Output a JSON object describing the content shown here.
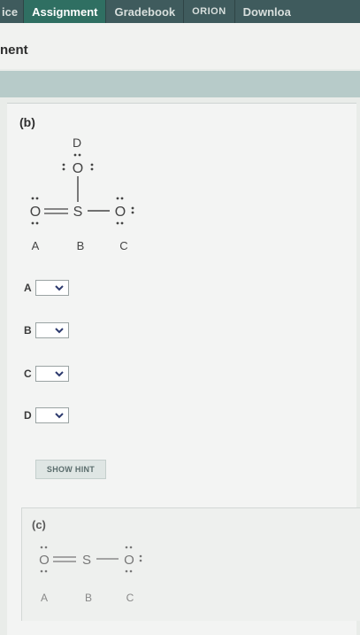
{
  "nav": {
    "tabs": [
      {
        "label": "ice",
        "active": false
      },
      {
        "label": "Assignment",
        "active": true
      },
      {
        "label": "Gradebook",
        "active": false
      },
      {
        "label": "ORION",
        "active": false
      },
      {
        "label": "Downloa",
        "active": false
      }
    ]
  },
  "header": {
    "title": "nent"
  },
  "part_b": {
    "label": "(b)",
    "structure": {
      "atoms": {
        "top": "O",
        "left": "O",
        "center": "S",
        "right": "O"
      },
      "letters": {
        "top": "D",
        "left": "A",
        "center": "B",
        "right": "C"
      }
    },
    "answers": [
      {
        "label": "A",
        "value": ""
      },
      {
        "label": "B",
        "value": ""
      },
      {
        "label": "C",
        "value": ""
      },
      {
        "label": "D",
        "value": ""
      }
    ],
    "hint_label": "SHOW HINT"
  },
  "part_c": {
    "label": "(c)",
    "structure": {
      "atoms": {
        "left": "O",
        "center": "S",
        "right": "O"
      },
      "letters": {
        "left": "A",
        "center": "B",
        "right": "C"
      }
    }
  },
  "colors": {
    "nav_bg": "#3f5b5d",
    "nav_active": "#2f6f62",
    "teal_bar": "#b7cbc9",
    "page_bg": "#f3f4f3"
  },
  "icons": [
    "chevron-down-icon"
  ]
}
